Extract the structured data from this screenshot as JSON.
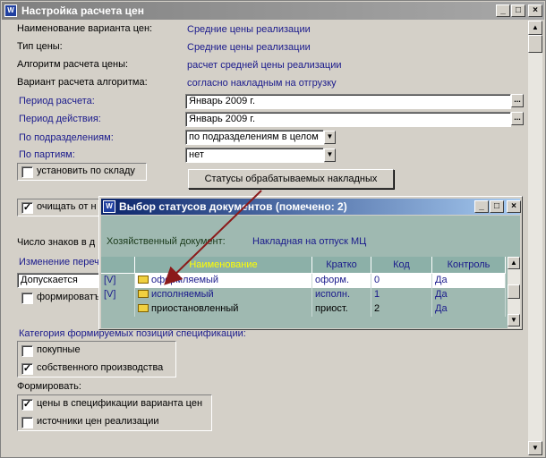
{
  "window": {
    "title": "Настройка расчета цен",
    "min": "_",
    "max": "□",
    "close": "×"
  },
  "info": {
    "variant_name": {
      "label": "Наименование варианта цен:",
      "value": "Средние цены реализации"
    },
    "price_type": {
      "label": "Тип цены:",
      "value": "Средние цены реализации"
    },
    "algorithm": {
      "label": "Алгоритм расчета цены:",
      "value": "расчет средней цены реализации"
    },
    "algorithm_variant": {
      "label": "Вариант расчета алгоритма:",
      "value": "согласно накладным на отгрузку"
    }
  },
  "fields": {
    "calc_period": {
      "label": "Период расчета:",
      "value": "Январь 2009 г."
    },
    "action_period": {
      "label": "Период действия:",
      "value": "Январь 2009 г."
    },
    "by_divisions": {
      "label": "По подразделениям:",
      "value": "по подразделениям в целом"
    },
    "by_batches": {
      "label": "По партиям:",
      "value": "нет"
    }
  },
  "ellipsis": "...",
  "dropdown_arrow": "▼",
  "checkboxes": {
    "by_warehouse": {
      "label": "установить по складу",
      "checked": false
    },
    "clear": {
      "label": "очищать от н",
      "checked": true
    },
    "form": {
      "label": "формироватъ",
      "checked": false
    },
    "purchased": {
      "label": "покупные",
      "checked": false
    },
    "own_production": {
      "label": "собственного производства",
      "checked": true
    },
    "prices_in_spec": {
      "label": "цены в спецификации варианта цен",
      "checked": true
    },
    "price_sources": {
      "label": "источники цен реализации",
      "checked": false
    }
  },
  "check_mark": "✓",
  "statuses_button": "Статусы обрабатываемых накладных",
  "digits_label": "Число знаков в д",
  "change_link": "Изменение переч",
  "allowed_value": "Допускается",
  "category_label": "Категория формируемых позиций спецификации:",
  "form_label": "Формировать:",
  "dialog": {
    "title": "Выбор статусов документов (помечено: 2)",
    "doc_label": "Хозяйственный документ:",
    "doc_value": "Накладная на отпуск МЦ",
    "columns": [
      "",
      "Наименование",
      "Кратко",
      "Код",
      "Контроль"
    ],
    "rows": [
      {
        "mark": "[V]",
        "name": "оформляемый",
        "short": "оформ.",
        "code": "0",
        "control": "Да"
      },
      {
        "mark": "[V]",
        "name": "исполняемый",
        "short": "исполн.",
        "code": "1",
        "control": "Да"
      },
      {
        "mark": "",
        "name": "приостановленный",
        "short": "приост.",
        "code": "2",
        "control": "Да"
      }
    ]
  },
  "scroll": {
    "up": "▲",
    "down": "▼"
  },
  "colors": {
    "title_active": "#0a246a",
    "title_inactive": "#808080",
    "link": "#1a1a8c",
    "dialog_body": "#9fb9b1",
    "header_text": "#ffff00",
    "arrow": "#8b1a1a"
  }
}
